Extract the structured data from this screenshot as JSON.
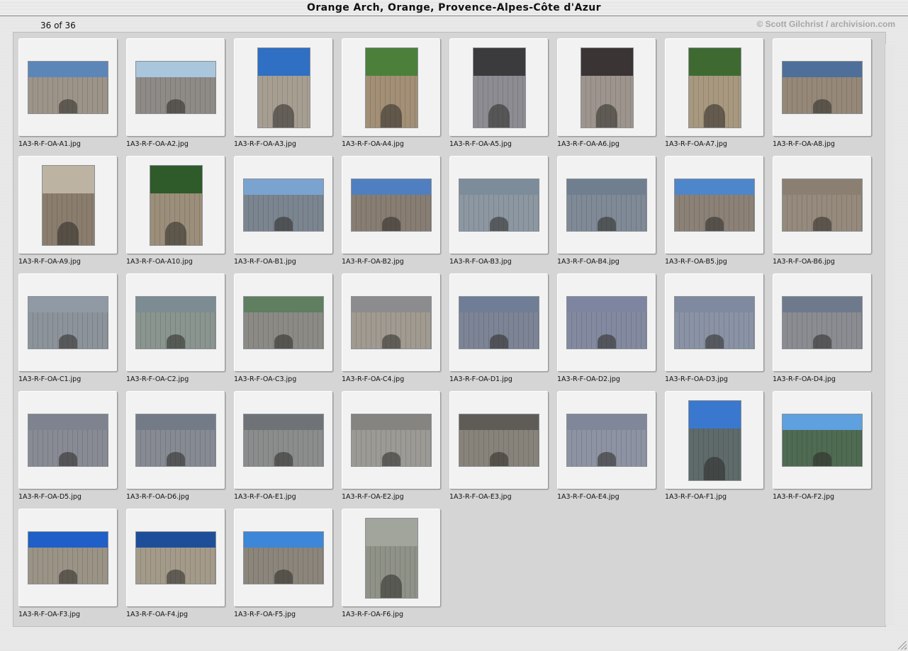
{
  "window": {
    "title": "Orange Arch, Orange, Provence-Alpes-Côte d'Azur",
    "counter": "36 of 36",
    "credit": "© Scott Gilchrist / archivision.com"
  },
  "thumbnails": [
    {
      "filename": "1A3-R-F-OA-A1.jpg",
      "orient": "land",
      "sky": "#5d86b8",
      "stone": "#9c9488"
    },
    {
      "filename": "1A3-R-F-OA-A2.jpg",
      "orient": "land",
      "sky": "#a9c6dc",
      "stone": "#8e8a86"
    },
    {
      "filename": "1A3-R-F-OA-A3.jpg",
      "orient": "port",
      "sky": "#2f6fc4",
      "stone": "#a79e92"
    },
    {
      "filename": "1A3-R-F-OA-A4.jpg",
      "orient": "port",
      "sky": "#4b7f3a",
      "stone": "#a28f75"
    },
    {
      "filename": "1A3-R-F-OA-A5.jpg",
      "orient": "port",
      "sky": "#3b3a3c",
      "stone": "#8c8c92"
    },
    {
      "filename": "1A3-R-F-OA-A6.jpg",
      "orient": "port",
      "sky": "#3a3434",
      "stone": "#9d958d"
    },
    {
      "filename": "1A3-R-F-OA-A7.jpg",
      "orient": "port",
      "sky": "#3e6a32",
      "stone": "#a8987f"
    },
    {
      "filename": "1A3-R-F-OA-A8.jpg",
      "orient": "land",
      "sky": "#4d6f99",
      "stone": "#958878"
    },
    {
      "filename": "1A3-R-F-OA-A9.jpg",
      "orient": "port",
      "sky": "#bdb3a3",
      "stone": "#8a7d6d"
    },
    {
      "filename": "1A3-R-F-OA-A10.jpg",
      "orient": "port",
      "sky": "#2f5a2a",
      "stone": "#9b8e7a"
    },
    {
      "filename": "1A3-R-F-OA-B1.jpg",
      "orient": "land",
      "sky": "#7aa3cf",
      "stone": "#7b8590"
    },
    {
      "filename": "1A3-R-F-OA-B2.jpg",
      "orient": "land",
      "sky": "#4f7fc0",
      "stone": "#877d72"
    },
    {
      "filename": "1A3-R-F-OA-B3.jpg",
      "orient": "land",
      "sky": "#7d8c9b",
      "stone": "#8c97a2"
    },
    {
      "filename": "1A3-R-F-OA-B4.jpg",
      "orient": "land",
      "sky": "#6f7f90",
      "stone": "#7f8a96"
    },
    {
      "filename": "1A3-R-F-OA-B5.jpg",
      "orient": "land",
      "sky": "#4e86cb",
      "stone": "#8b8176"
    },
    {
      "filename": "1A3-R-F-OA-B6.jpg",
      "orient": "land",
      "sky": "#8b7f72",
      "stone": "#958a7c"
    },
    {
      "filename": "1A3-R-F-OA-C1.jpg",
      "orient": "land",
      "sky": "#8f9aa4",
      "stone": "#8c939a"
    },
    {
      "filename": "1A3-R-F-OA-C2.jpg",
      "orient": "land",
      "sky": "#7d8b92",
      "stone": "#8a958f"
    },
    {
      "filename": "1A3-R-F-OA-C3.jpg",
      "orient": "land",
      "sky": "#5f7f60",
      "stone": "#8b8a84"
    },
    {
      "filename": "1A3-R-F-OA-C4.jpg",
      "orient": "land",
      "sky": "#8c8c8e",
      "stone": "#a09a91"
    },
    {
      "filename": "1A3-R-F-OA-D1.jpg",
      "orient": "land",
      "sky": "#6f7d96",
      "stone": "#7c8496"
    },
    {
      "filename": "1A3-R-F-OA-D2.jpg",
      "orient": "land",
      "sky": "#7d85a0",
      "stone": "#838aa0"
    },
    {
      "filename": "1A3-R-F-OA-D3.jpg",
      "orient": "land",
      "sky": "#7f8aa0",
      "stone": "#8a93a5"
    },
    {
      "filename": "1A3-R-F-OA-D4.jpg",
      "orient": "land",
      "sky": "#6e7a8c",
      "stone": "#8a8c92"
    },
    {
      "filename": "1A3-R-F-OA-D5.jpg",
      "orient": "land",
      "sky": "#7e838f",
      "stone": "#888b94"
    },
    {
      "filename": "1A3-R-F-OA-D6.jpg",
      "orient": "land",
      "sky": "#737b87",
      "stone": "#868a93"
    },
    {
      "filename": "1A3-R-F-OA-E1.jpg",
      "orient": "land",
      "sky": "#6f7378",
      "stone": "#8b8c8c"
    },
    {
      "filename": "1A3-R-F-OA-E2.jpg",
      "orient": "land",
      "sky": "#858481",
      "stone": "#9b9a95"
    },
    {
      "filename": "1A3-R-F-OA-E3.jpg",
      "orient": "land",
      "sky": "#5f5c57",
      "stone": "#88837a"
    },
    {
      "filename": "1A3-R-F-OA-E4.jpg",
      "orient": "land",
      "sky": "#80879a",
      "stone": "#8d93a2"
    },
    {
      "filename": "1A3-R-F-OA-F1.jpg",
      "orient": "port",
      "sky": "#3a78cf",
      "stone": "#5e6b6a"
    },
    {
      "filename": "1A3-R-F-OA-F2.jpg",
      "orient": "land",
      "sky": "#5fa0de",
      "stone": "#4f6b52"
    },
    {
      "filename": "1A3-R-F-OA-F3.jpg",
      "orient": "land",
      "sky": "#1f5fc7",
      "stone": "#9a9386"
    },
    {
      "filename": "1A3-R-F-OA-F4.jpg",
      "orient": "land",
      "sky": "#1e4e9a",
      "stone": "#a39a89"
    },
    {
      "filename": "1A3-R-F-OA-F5.jpg",
      "orient": "land",
      "sky": "#3e86d8",
      "stone": "#8b857b"
    },
    {
      "filename": "1A3-R-F-OA-F6.jpg",
      "orient": "port",
      "sky": "#a2a59c",
      "stone": "#8f9287"
    }
  ]
}
